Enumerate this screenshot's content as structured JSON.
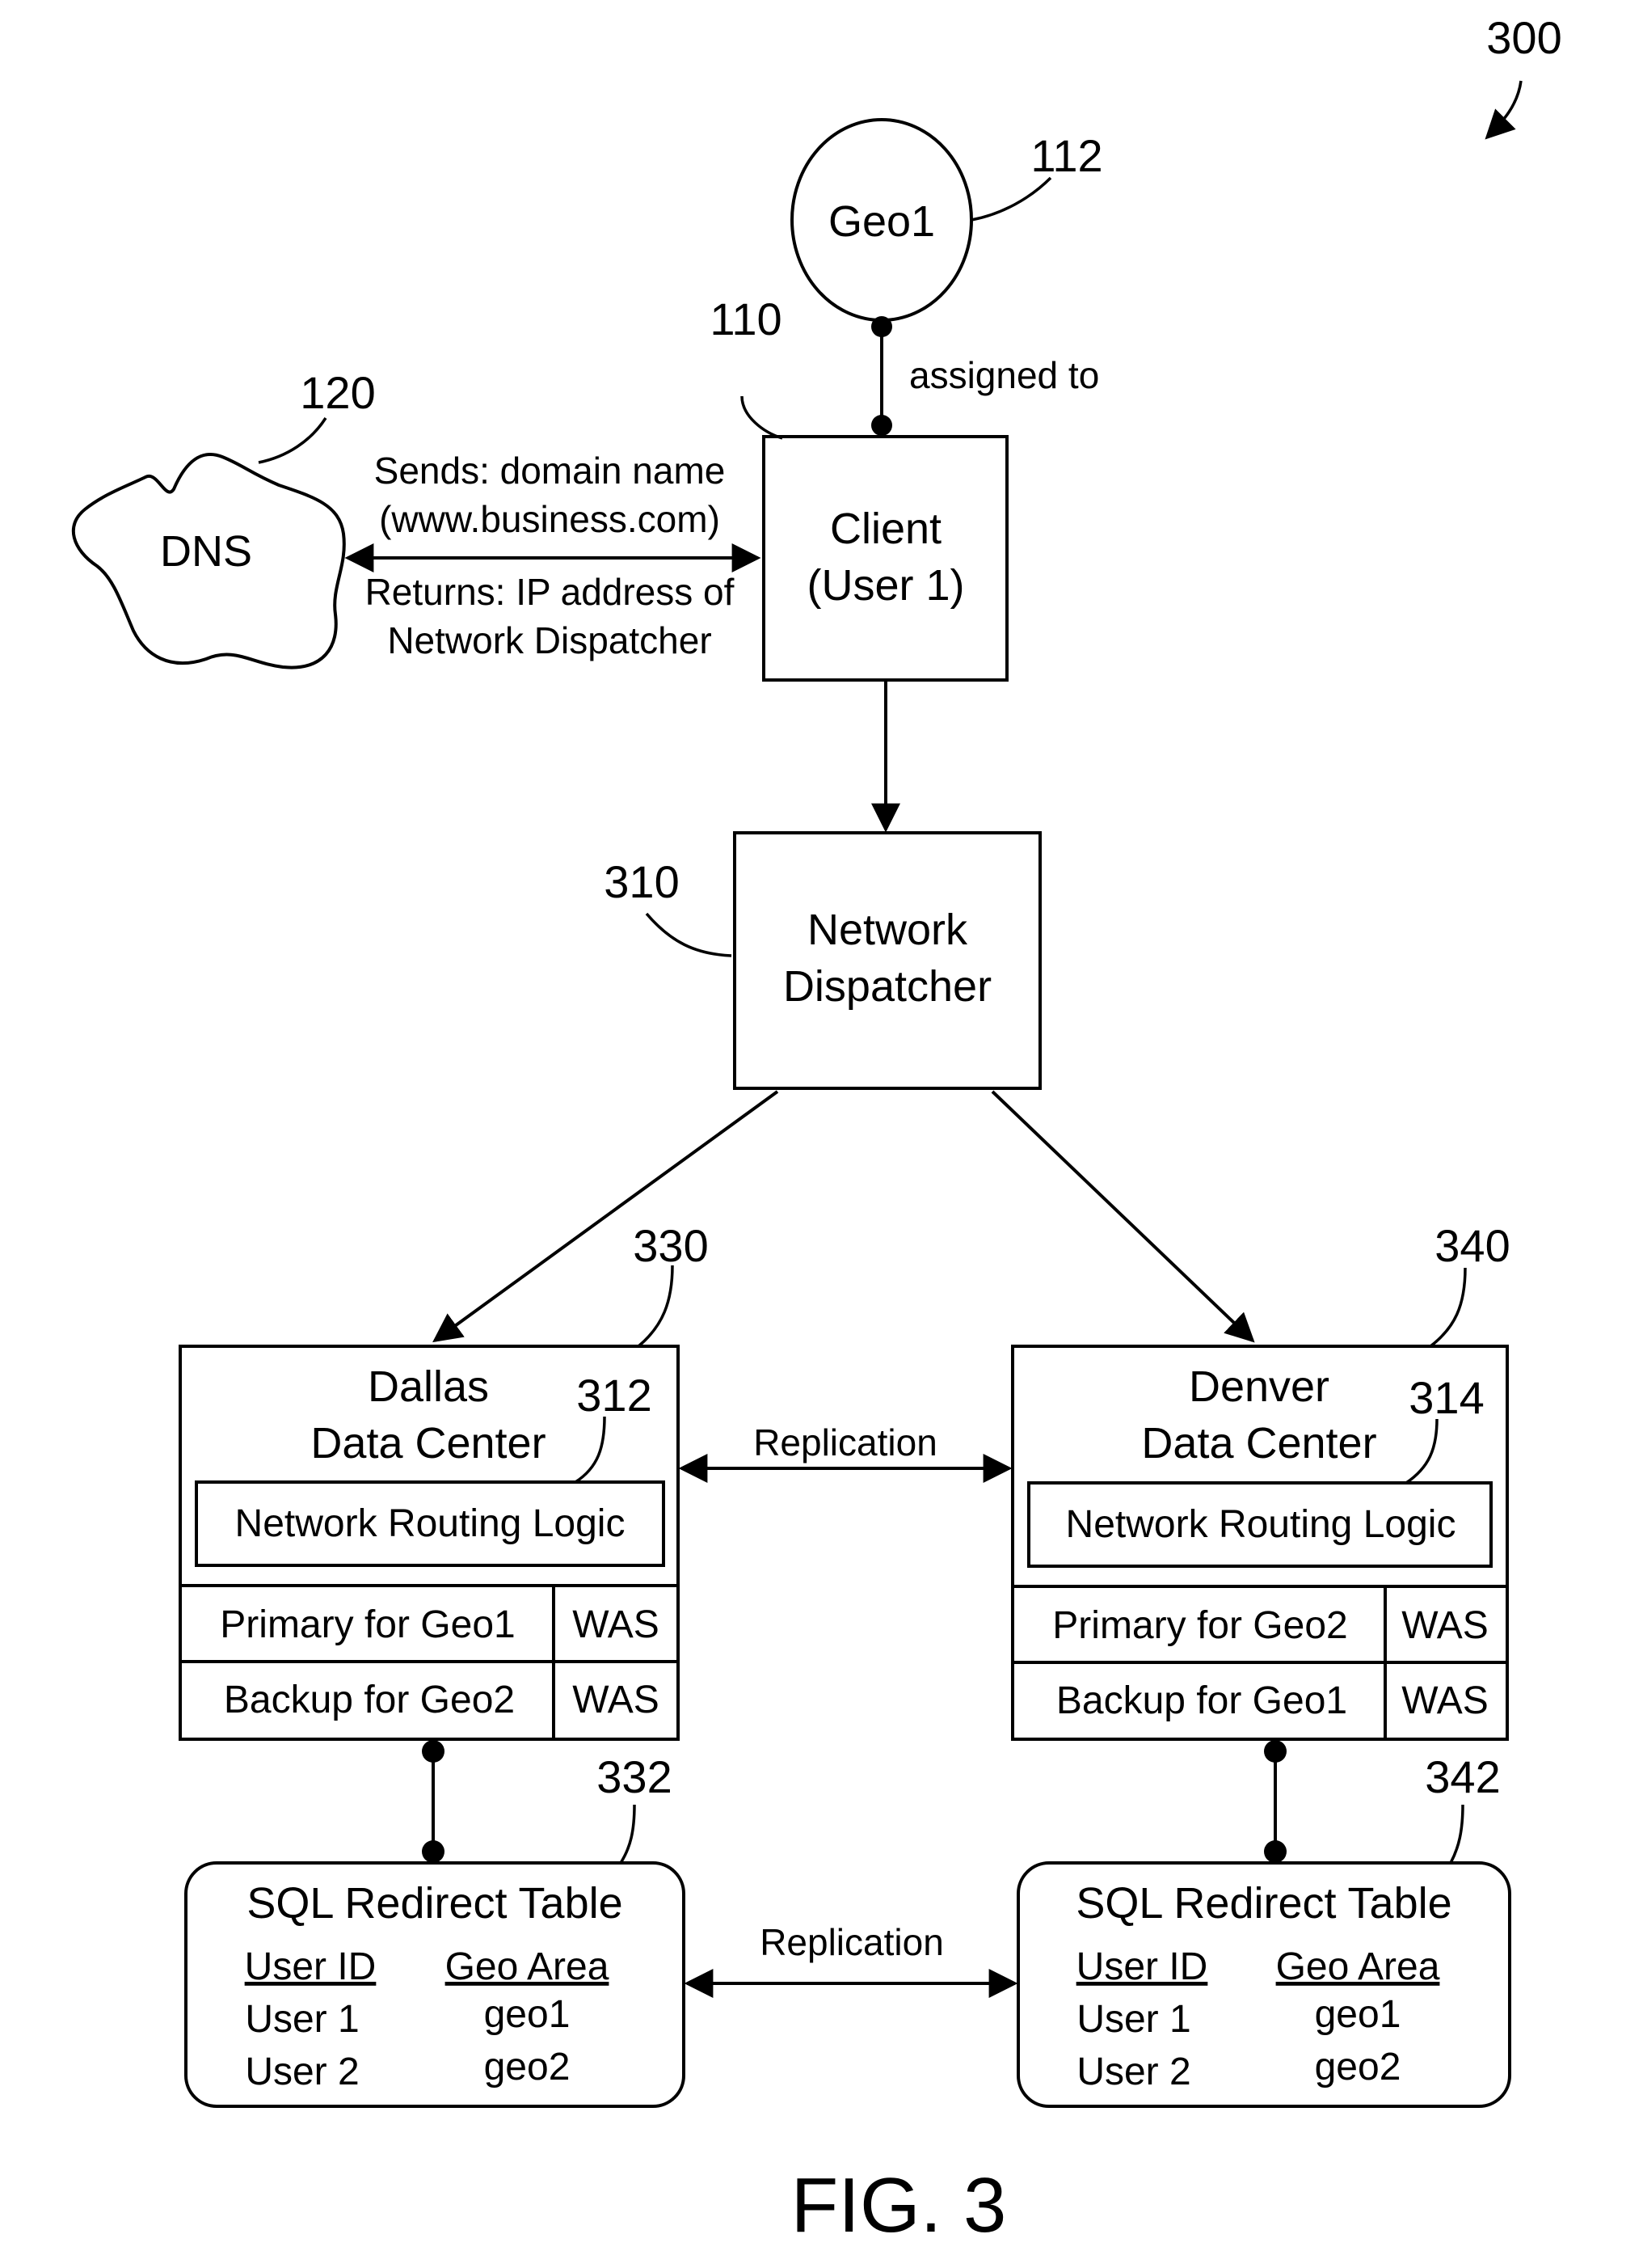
{
  "figure": {
    "number_ref": "300",
    "caption": "FIG. 3"
  },
  "geo": {
    "label": "Geo1",
    "ref": "112"
  },
  "assigned_label": "assigned to",
  "client": {
    "line1": "Client",
    "line2": "(User 1)",
    "ref": "110"
  },
  "dns": {
    "label": "DNS",
    "ref": "120"
  },
  "dns_exchange": {
    "sends_line1": "Sends: domain name",
    "sends_line2": "(www.business.com)",
    "returns_line1": "Returns: IP address of",
    "returns_line2": "Network Dispatcher"
  },
  "dispatcher": {
    "line1": "Network",
    "line2": "Dispatcher",
    "ref": "310"
  },
  "data_centers": [
    {
      "name_line1": "Dallas",
      "name_line2": "Data Center",
      "ref": "330",
      "routing_ref": "312",
      "routing_label": "Network Routing Logic",
      "rows": [
        {
          "role": "Primary for Geo1",
          "server": "WAS"
        },
        {
          "role": "Backup for Geo2",
          "server": "WAS"
        }
      ]
    },
    {
      "name_line1": "Denver",
      "name_line2": "Data Center",
      "ref": "340",
      "routing_ref": "314",
      "routing_label": "Network Routing Logic",
      "rows": [
        {
          "role": "Primary for Geo2",
          "server": "WAS"
        },
        {
          "role": "Backup for Geo1",
          "server": "WAS"
        }
      ]
    }
  ],
  "replication_label": "Replication",
  "sql_tables": [
    {
      "ref": "332",
      "title": "SQL Redirect Table",
      "headers": [
        "User ID",
        "Geo Area"
      ],
      "rows": [
        [
          "User 1",
          "geo1"
        ],
        [
          "User 2",
          "geo2"
        ]
      ]
    },
    {
      "ref": "342",
      "title": "SQL Redirect Table",
      "headers": [
        "User ID",
        "Geo Area"
      ],
      "rows": [
        [
          "User 1",
          "geo1"
        ],
        [
          "User 2",
          "geo2"
        ]
      ]
    }
  ]
}
